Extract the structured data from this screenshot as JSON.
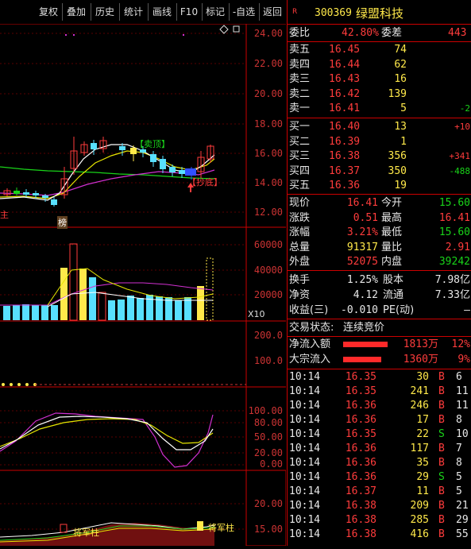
{
  "toolbar": {
    "buttons": [
      "复权",
      "叠加",
      "历史",
      "统计",
      "画线",
      "F10",
      "标记",
      "-自选",
      "返回"
    ]
  },
  "stock": {
    "badge": "R",
    "code": "300369",
    "name": "绿盟科技"
  },
  "committee": {
    "wb_label": "委比",
    "wb_value": "42.80%",
    "wc_label": "委差",
    "wc_value": "443"
  },
  "asks": [
    {
      "label": "卖五",
      "price": "16.45",
      "vol": "74",
      "chg": ""
    },
    {
      "label": "卖四",
      "price": "16.44",
      "vol": "62",
      "chg": ""
    },
    {
      "label": "卖三",
      "price": "16.43",
      "vol": "16",
      "chg": ""
    },
    {
      "label": "卖二",
      "price": "16.42",
      "vol": "139",
      "chg": ""
    },
    {
      "label": "卖一",
      "price": "16.41",
      "vol": "5",
      "chg": "-2"
    }
  ],
  "bids": [
    {
      "label": "买一",
      "price": "16.40",
      "vol": "13",
      "chg": "+10"
    },
    {
      "label": "买二",
      "price": "16.39",
      "vol": "1",
      "chg": ""
    },
    {
      "label": "买三",
      "price": "16.38",
      "vol": "356",
      "chg": "+341"
    },
    {
      "label": "买四",
      "price": "16.37",
      "vol": "350",
      "chg": "-488"
    },
    {
      "label": "买五",
      "price": "16.36",
      "vol": "19",
      "chg": ""
    }
  ],
  "quote": [
    {
      "l1": "现价",
      "v1": "16.41",
      "c1": "red",
      "l2": "今开",
      "v2": "15.60",
      "c2": "green"
    },
    {
      "l1": "涨跌",
      "v1": "0.51",
      "c1": "red",
      "l2": "最高",
      "v2": "16.41",
      "c2": "red"
    },
    {
      "l1": "涨幅",
      "v1": "3.21%",
      "c1": "red",
      "l2": "最低",
      "v2": "15.60",
      "c2": "green"
    },
    {
      "l1": "总量",
      "v1": "91317",
      "c1": "yellow",
      "l2": "量比",
      "v2": "2.91",
      "c2": "red"
    },
    {
      "l1": "外盘",
      "v1": "52075",
      "c1": "red",
      "l2": "内盘",
      "v2": "39242",
      "c2": "green"
    }
  ],
  "quote2": [
    {
      "l1": "换手",
      "v1": "1.25%",
      "l2": "股本",
      "v2": "7.98亿"
    },
    {
      "l1": "净资",
      "v1": "4.12",
      "l2": "流通",
      "v2": "7.33亿"
    },
    {
      "l1": "收益(三)",
      "v1": "-0.010",
      "l2": "PE(动)",
      "v2": "–"
    }
  ],
  "trade_status": {
    "label": "交易状态:",
    "value": "连续竞价"
  },
  "flows": [
    {
      "label": "净流入额",
      "value": "1813万",
      "pct": "12%",
      "bar": 0.8
    },
    {
      "label": "大宗流入",
      "value": "1360万",
      "pct": "9%",
      "bar": 0.68
    }
  ],
  "ticks": [
    {
      "t": "10:14",
      "p": "16.35",
      "v": "30",
      "d": "B",
      "n": "6"
    },
    {
      "t": "10:14",
      "p": "16.35",
      "v": "241",
      "d": "B",
      "n": "11"
    },
    {
      "t": "10:14",
      "p": "16.36",
      "v": "246",
      "d": "B",
      "n": "11"
    },
    {
      "t": "10:14",
      "p": "16.36",
      "v": "17",
      "d": "B",
      "n": "8"
    },
    {
      "t": "10:14",
      "p": "16.35",
      "v": "22",
      "d": "S",
      "n": "10"
    },
    {
      "t": "10:14",
      "p": "16.36",
      "v": "117",
      "d": "B",
      "n": "7"
    },
    {
      "t": "10:14",
      "p": "16.36",
      "v": "35",
      "d": "B",
      "n": "8"
    },
    {
      "t": "10:14",
      "p": "16.36",
      "v": "29",
      "d": "S",
      "n": "5"
    },
    {
      "t": "10:14",
      "p": "16.37",
      "v": "11",
      "d": "B",
      "n": "5"
    },
    {
      "t": "10:14",
      "p": "16.38",
      "v": "209",
      "d": "B",
      "n": "21"
    },
    {
      "t": "10:14",
      "p": "16.38",
      "v": "285",
      "d": "B",
      "n": "29"
    },
    {
      "t": "10:14",
      "p": "16.38",
      "v": "416",
      "d": "B",
      "n": "55"
    }
  ],
  "axis": {
    "price": [
      "24.00",
      "22.00",
      "20.00",
      "18.00",
      "16.00",
      "14.00",
      "12.00"
    ],
    "volume": [
      "60000",
      "40000",
      "20000"
    ],
    "volume_unit": "X10",
    "ind1": [
      "200.0",
      "100.0"
    ],
    "kdj": [
      "100.00",
      "80.00",
      "50.00",
      "20.00",
      "0.00"
    ],
    "ind3": [
      "20.00",
      "15.00"
    ]
  },
  "annotations": {
    "sell_top": "【卖顶】",
    "buy_bottom": "【抄底】",
    "bang": "榜",
    "left_tag": "主",
    "general1": "将军柱",
    "general2": "将军柱"
  },
  "colors": {
    "up": "#ff3c3c",
    "down": "#19d419",
    "volume": "#58e0ff",
    "grid": "#c00000"
  }
}
